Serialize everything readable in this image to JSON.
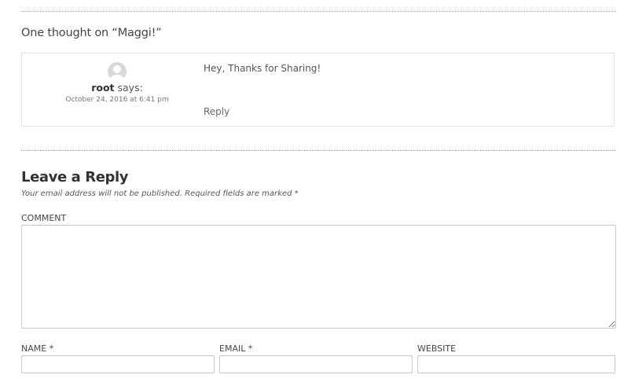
{
  "comments": {
    "title": "One thought on “Maggi!”",
    "items": [
      {
        "author": "root",
        "says": "says:",
        "date": "October 24, 2016 at 6:41 pm",
        "text": "Hey, Thanks for Sharing!",
        "reply_label": "Reply"
      }
    ]
  },
  "reply_form": {
    "title": "Leave a Reply",
    "notes": "Your email address will not be published. Required fields are marked *",
    "comment_label": "COMMENT",
    "comment_value": "",
    "name_label": "NAME *",
    "name_value": "",
    "email_label": "EMAIL *",
    "email_value": "",
    "website_label": "WEBSITE",
    "website_value": ""
  }
}
